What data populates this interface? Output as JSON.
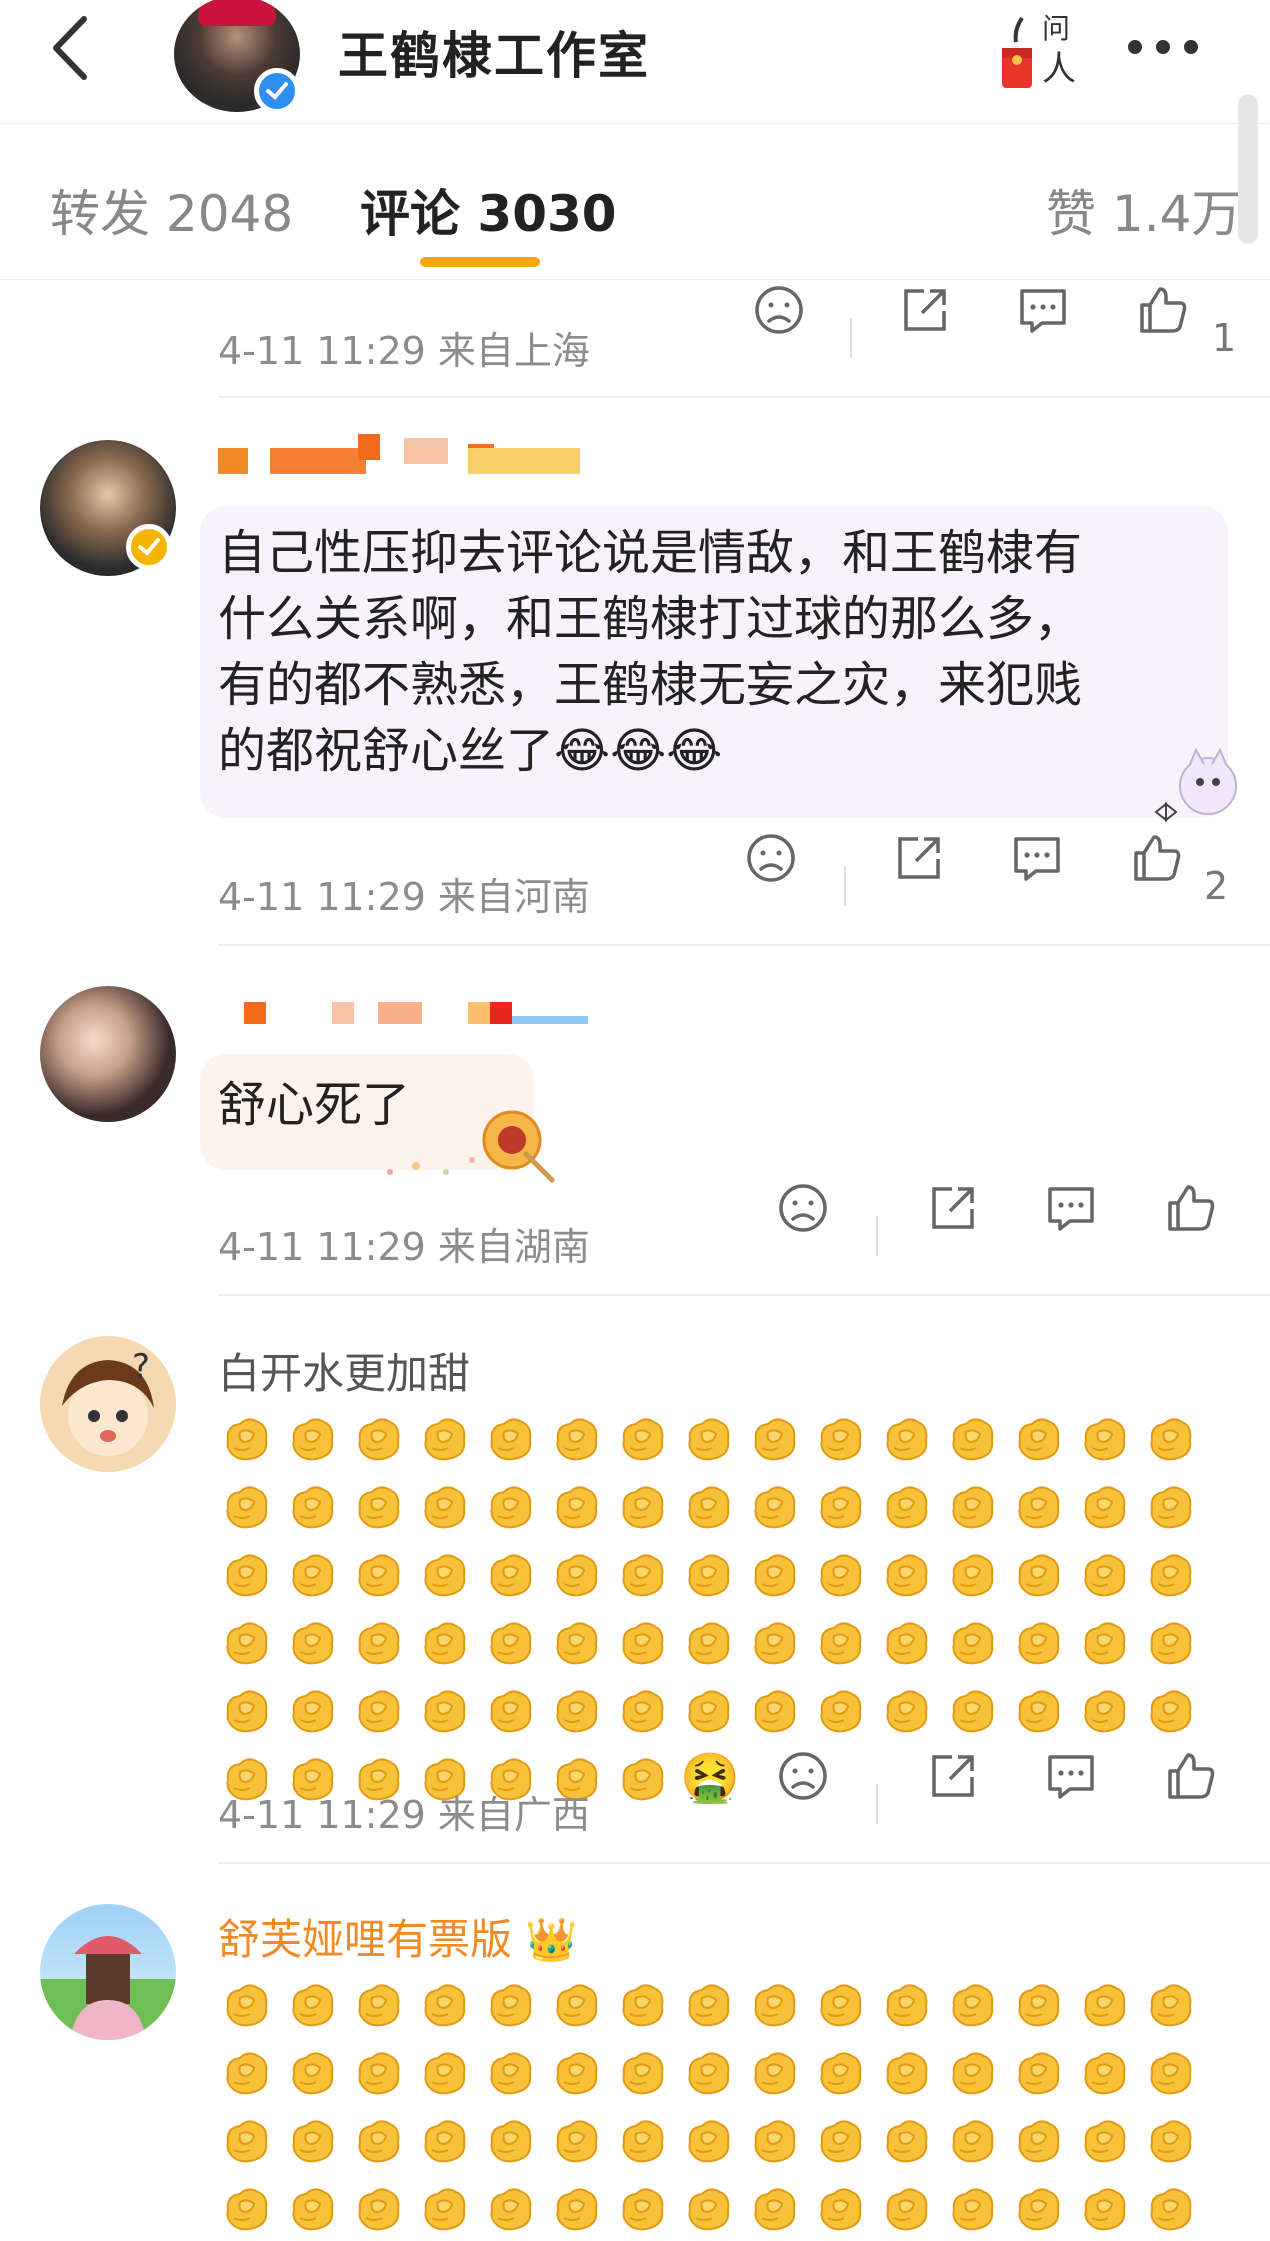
{
  "header": {
    "title": "王鹤棣工作室",
    "ask_label": "问人"
  },
  "tabs": [
    {
      "label": "转发 2048"
    },
    {
      "label": "评论 3030"
    },
    {
      "label": "赞 1.4万"
    }
  ],
  "comments": [
    {
      "meta": "4-11 11:29  来自上海",
      "likes": "1"
    },
    {
      "text": "自己性压抑去评论说是情敌，和王鹤棣有什么关系啊，和王鹤棣打过球的那么多，有的都不熟悉，王鹤棣无妄之灾，来犯贱的都祝舒心丝了😂😂😂",
      "text_lines": [
        "自己性压抑去评论说是情敌，和王鹤棣有",
        "什么关系啊，和王鹤棣打过球的那么多，",
        "有的都不熟悉，王鹤棣无妄之灾，来犯贱",
        "的都祝舒心丝了"
      ],
      "emoji": "😂😂😂",
      "meta": "4-11 11:29  来自河南",
      "likes": "2"
    },
    {
      "text": "舒心死了",
      "meta": "4-11 11:29  来自湖南",
      "likes": ""
    },
    {
      "nickname": "白开水更加甜",
      "fist_count": 82,
      "end_emoji": "🤮",
      "meta": "4-11 11:29  来自广西",
      "likes": ""
    },
    {
      "nickname": "舒芙娅哩有票版",
      "badge": "👑",
      "fist_count": 60
    }
  ],
  "colors": {
    "accent": "#f6a51b",
    "verify_blue": "#2e8ff0",
    "verify_gold": "#f5b400",
    "orange_nick": "#f08a24"
  },
  "icons": [
    "back-icon",
    "verified-icon",
    "red-envelope-icon",
    "more-icon",
    "sad-face-icon",
    "share-icon",
    "comment-icon",
    "thumbs-up-icon"
  ]
}
